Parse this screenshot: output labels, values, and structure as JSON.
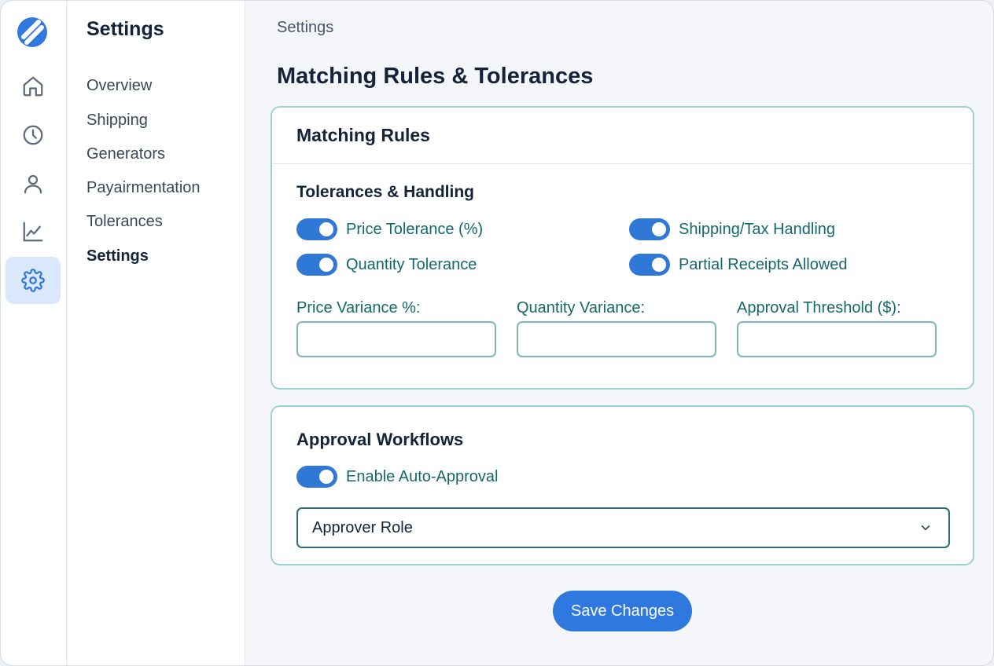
{
  "rail": {
    "items": [
      {
        "icon": "home-icon"
      },
      {
        "icon": "clock-icon"
      },
      {
        "icon": "user-icon"
      },
      {
        "icon": "chart-icon"
      },
      {
        "icon": "gear-icon"
      }
    ],
    "active": "gear-icon",
    "accent": "#2f78e0"
  },
  "subnav": {
    "title": "Settings",
    "items": [
      {
        "label": "Overview"
      },
      {
        "label": "Shipping"
      },
      {
        "label": "Generators"
      },
      {
        "label": "Payairmentation"
      },
      {
        "label": "Tolerances"
      },
      {
        "label": "Settings"
      }
    ]
  },
  "header": {
    "breadcrumb": "Settings",
    "title": "Matching Rules & Tolerances"
  },
  "matching_rules": {
    "card_title": "Matching Rules",
    "section_title": "Tolerances & Handling",
    "toggles": [
      {
        "label": "Price Tolerance (%)",
        "on": true
      },
      {
        "label": "Shipping/Tax Handling",
        "on": true
      },
      {
        "label": "Quantity Tolerance",
        "on": true
      },
      {
        "label": "Partial Receipts Allowed",
        "on": true
      }
    ],
    "fields": [
      {
        "label": "Price Variance %:",
        "value": ""
      },
      {
        "label": "Quantity Variance:",
        "value": ""
      },
      {
        "label": "Approval Threshold ($):",
        "value": ""
      }
    ]
  },
  "approval": {
    "card_title": "Approval Workflows",
    "toggle_label": "Enable Auto-Approval",
    "toggle_on": true,
    "select_value": "Approver Role"
  },
  "actions": {
    "save_label": "Save Changes"
  },
  "colors": {
    "toggle_on": "#2f78d6",
    "label_teal": "#13696a",
    "card_border": "#9fd0d0",
    "button": "#2f78e0"
  }
}
